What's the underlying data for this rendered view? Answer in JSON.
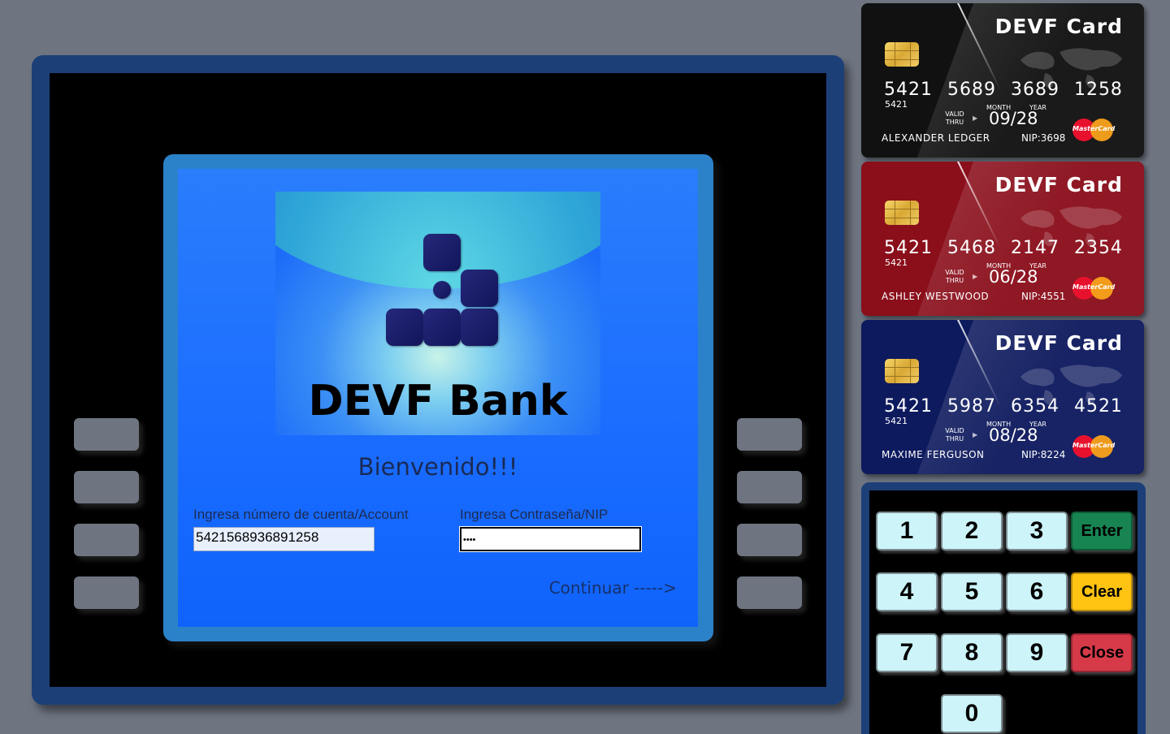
{
  "bank": {
    "name": "DEVF Bank"
  },
  "login": {
    "welcome": "Bienvenido!!!",
    "account_label": "Ingresa número de cuenta/Account",
    "account_value": "5421568936891258",
    "pin_label": "Ingresa Contraseña/NIP",
    "pin_value": "••••",
    "continue": "Continuar ----->"
  },
  "cards": [
    {
      "brand": "DEVF Card",
      "number": "5421 5689 3689 1258",
      "prefix": "5421",
      "valid_thru": "VALID THRU",
      "month_label": "MONTH",
      "year_label": "YEAR",
      "expiry": "09/28",
      "holder": "ALEXANDER LEDGER",
      "nip": "NIP:3698",
      "network": "MasterCard",
      "color": "#111111"
    },
    {
      "brand": "DEVF Card",
      "number": "5421 5468 2147 2354",
      "prefix": "5421",
      "valid_thru": "VALID THRU",
      "month_label": "MONTH",
      "year_label": "YEAR",
      "expiry": "06/28",
      "holder": "ASHLEY WESTWOOD",
      "nip": "NIP:4551",
      "network": "MasterCard",
      "color": "#8a0f1b"
    },
    {
      "brand": "DEVF Card",
      "number": "5421 5987 6354 4521",
      "prefix": "5421",
      "valid_thru": "VALID THRU",
      "month_label": "MONTH",
      "year_label": "YEAR",
      "expiry": "08/28",
      "holder": "MAXIME FERGUSON",
      "nip": "NIP:8224",
      "network": "MasterCard",
      "color": "#0e1a5e"
    }
  ],
  "keypad": {
    "keys": [
      "1",
      "2",
      "3",
      "4",
      "5",
      "6",
      "7",
      "8",
      "9",
      "0"
    ],
    "enter": "Enter",
    "clear": "Clear",
    "close": "Close"
  },
  "colors": {
    "page_bg": "#6e7581",
    "atm_frame": "#1c3f78",
    "screen_frame": "#2c82c9",
    "screen": "#1a6cff",
    "enter": "#178452",
    "clear": "#ffc312",
    "close": "#d63a49",
    "key": "#cdf5f9"
  }
}
